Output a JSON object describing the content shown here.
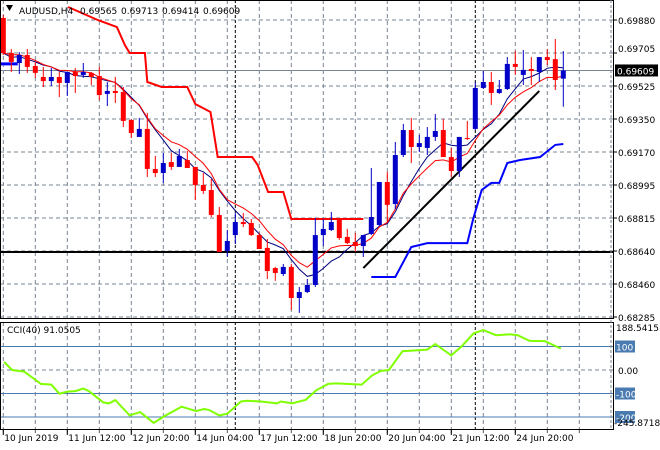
{
  "header": {
    "symbol_tf": "AUDUSD,H4",
    "open": "0.69565",
    "high": "0.69713",
    "low": "0.69414",
    "close": "0.69609"
  },
  "colors": {
    "bull": "#0000c8",
    "bear": "#ff0000",
    "grid": "#7a8696",
    "cci": "#7fff00",
    "level": "#4a7bb0",
    "upper_channel": "#ff0000",
    "lower_channel": "#0000ff",
    "trend": "#000000"
  },
  "chart_data": {
    "type": "candlestick",
    "title": "AUDUSD,H4",
    "ylim": [
      0.682,
      0.6995
    ],
    "y_ticks": [
      "0.69880",
      "0.69705",
      "0.69525",
      "0.69350",
      "0.69170",
      "0.68995",
      "0.68815",
      "0.68640",
      "0.68460",
      "0.68285"
    ],
    "current_price": "0.69609",
    "x_ticks": [
      {
        "index": 0,
        "label": "10 Jun 2019"
      },
      {
        "index": 8,
        "label": "11 Jun 12:00"
      },
      {
        "index": 16,
        "label": "12 Jun 20:00"
      },
      {
        "index": 24,
        "label": "14 Jun 04:00"
      },
      {
        "index": 32,
        "label": "17 Jun 12:00"
      },
      {
        "index": 40,
        "label": "18 Jun 20:00"
      },
      {
        "index": 48,
        "label": "20 Jun 04:00"
      },
      {
        "index": 56,
        "label": "21 Jun 12:00"
      },
      {
        "index": 64,
        "label": "24 Jun 20:00"
      }
    ],
    "period_separators": [
      29,
      59
    ],
    "candles_ohlc": [
      [
        0.69891,
        0.69907,
        0.69692,
        0.69703
      ],
      [
        0.69703,
        0.69724,
        0.69601,
        0.69655
      ],
      [
        0.69649,
        0.69708,
        0.6959,
        0.69692
      ],
      [
        0.69692,
        0.69724,
        0.69596,
        0.69628
      ],
      [
        0.69633,
        0.69655,
        0.69569,
        0.69596
      ],
      [
        0.69574,
        0.69628,
        0.6952,
        0.69552
      ],
      [
        0.69552,
        0.69622,
        0.69526,
        0.69574
      ],
      [
        0.69574,
        0.69601,
        0.69466,
        0.69542
      ],
      [
        0.69542,
        0.69601,
        0.69472,
        0.69601
      ],
      [
        0.69601,
        0.69622,
        0.69488,
        0.69579
      ],
      [
        0.69585,
        0.69649,
        0.69569,
        0.69601
      ],
      [
        0.69596,
        0.69601,
        0.69531,
        0.69574
      ],
      [
        0.69579,
        0.69628,
        0.6945,
        0.69477
      ],
      [
        0.69483,
        0.69547,
        0.69418,
        0.69499
      ],
      [
        0.69499,
        0.69574,
        0.69434,
        0.69488
      ],
      [
        0.69493,
        0.6952,
        0.69305,
        0.69338
      ],
      [
        0.69343,
        0.69348,
        0.69246,
        0.69273
      ],
      [
        0.69252,
        0.69354,
        0.69252,
        0.69295
      ],
      [
        0.69295,
        0.69381,
        0.69037,
        0.6908
      ],
      [
        0.6908,
        0.6915,
        0.69037,
        0.69058
      ],
      [
        0.69058,
        0.69166,
        0.69005,
        0.69112
      ],
      [
        0.69117,
        0.69166,
        0.69075,
        0.69091
      ],
      [
        0.69091,
        0.69187,
        0.69091,
        0.6915
      ],
      [
        0.69128,
        0.69177,
        0.69085,
        0.69085
      ],
      [
        0.69091,
        0.69091,
        0.68913,
        0.68994
      ],
      [
        0.68994,
        0.69058,
        0.68946,
        0.68962
      ],
      [
        0.68967,
        0.69026,
        0.68822,
        0.68833
      ],
      [
        0.68833,
        0.68876,
        0.68634,
        0.68634
      ],
      [
        0.6864,
        0.68752,
        0.68607,
        0.68693
      ],
      [
        0.68725,
        0.68843,
        0.68677,
        0.68795
      ],
      [
        0.68795,
        0.68843,
        0.68768,
        0.68784
      ],
      [
        0.6879,
        0.68811,
        0.6872,
        0.68725
      ],
      [
        0.68725,
        0.68736,
        0.6865,
        0.6865
      ],
      [
        0.68656,
        0.68704,
        0.68489,
        0.68532
      ],
      [
        0.68548,
        0.68554,
        0.68479,
        0.68521
      ],
      [
        0.68516,
        0.6857,
        0.68505,
        0.68554
      ],
      [
        0.68554,
        0.6857,
        0.68323,
        0.68387
      ],
      [
        0.68387,
        0.68446,
        0.68307,
        0.68419
      ],
      [
        0.68419,
        0.68489,
        0.68414,
        0.68457
      ],
      [
        0.68457,
        0.68817,
        0.68446,
        0.68725
      ],
      [
        0.68725,
        0.68811,
        0.68666,
        0.68758
      ],
      [
        0.68752,
        0.68849,
        0.68747,
        0.68795
      ],
      [
        0.68811,
        0.68817,
        0.68699,
        0.68709
      ],
      [
        0.68715,
        0.68758,
        0.68677,
        0.68682
      ],
      [
        0.68688,
        0.68736,
        0.68634,
        0.68666
      ],
      [
        0.68666,
        0.68725,
        0.68607,
        0.68725
      ],
      [
        0.68731,
        0.69085,
        0.68725,
        0.68822
      ],
      [
        0.68779,
        0.6901,
        0.68774,
        0.6901
      ],
      [
        0.6901,
        0.69064,
        0.6879,
        0.68887
      ],
      [
        0.68892,
        0.69225,
        0.68865,
        0.69155
      ],
      [
        0.69155,
        0.69322,
        0.69144,
        0.69289
      ],
      [
        0.69289,
        0.69354,
        0.69112,
        0.69198
      ],
      [
        0.69198,
        0.69262,
        0.69171,
        0.69219
      ],
      [
        0.69193,
        0.69305,
        0.69155,
        0.69252
      ],
      [
        0.69252,
        0.69375,
        0.6923,
        0.69284
      ],
      [
        0.69289,
        0.69348,
        0.69144,
        0.69144
      ],
      [
        0.69144,
        0.69193,
        0.69037,
        0.69069
      ],
      [
        0.69069,
        0.69252,
        0.69037,
        0.69252
      ],
      [
        0.69246,
        0.69338,
        0.69236,
        0.69241
      ],
      [
        0.69295,
        0.69547,
        0.69289,
        0.69515
      ],
      [
        0.69515,
        0.69606,
        0.69509,
        0.69547
      ],
      [
        0.69547,
        0.69601,
        0.69424,
        0.69488
      ],
      [
        0.69488,
        0.69558,
        0.69483,
        0.69509
      ],
      [
        0.69509,
        0.69681,
        0.69504,
        0.69644
      ],
      [
        0.69644,
        0.69714,
        0.69585,
        0.69628
      ],
      [
        0.69585,
        0.69719,
        0.69531,
        0.69612
      ],
      [
        0.69617,
        0.69681,
        0.69531,
        0.69606
      ],
      [
        0.69601,
        0.69681,
        0.69547,
        0.69681
      ],
      [
        0.69681,
        0.69724,
        0.69638,
        0.69665
      ],
      [
        0.6967,
        0.69778,
        0.69504,
        0.69558
      ],
      [
        0.69565,
        0.69713,
        0.69414,
        0.69609
      ]
    ],
    "upper_channel": [
      [
        8.1,
        0.6995
      ],
      [
        11.8,
        0.6988
      ],
      [
        14.2,
        0.69842
      ],
      [
        15.2,
        0.69745
      ],
      [
        15.8,
        0.69703
      ],
      [
        17.7,
        0.69703
      ],
      [
        18,
        0.69547
      ],
      [
        19.8,
        0.6952
      ],
      [
        23,
        0.6952
      ],
      [
        24,
        0.69429
      ],
      [
        25.9,
        0.69386
      ],
      [
        26.8,
        0.69144
      ],
      [
        31.1,
        0.69144
      ],
      [
        31.8,
        0.69101
      ],
      [
        33.1,
        0.68956
      ],
      [
        35,
        0.68956
      ],
      [
        36,
        0.68811
      ],
      [
        45,
        0.68811
      ]
    ],
    "lower_channel_prev": [
      [
        -0.4,
        0.69644
      ],
      [
        1.8,
        0.69644
      ]
    ],
    "lower_channel": [
      [
        46,
        0.685
      ],
      [
        49,
        0.685
      ],
      [
        51,
        0.68661
      ],
      [
        53,
        0.68682
      ],
      [
        58,
        0.68682
      ],
      [
        58.7,
        0.68806
      ],
      [
        59.8,
        0.68967
      ],
      [
        61,
        0.69005
      ],
      [
        62,
        0.69005
      ],
      [
        63,
        0.69112
      ],
      [
        64.6,
        0.69128
      ],
      [
        67.1,
        0.69144
      ],
      [
        69,
        0.69209
      ],
      [
        70,
        0.69214
      ]
    ],
    "support_line": 0.68634,
    "trend_line": {
      "from": [
        45,
        0.68548
      ],
      "to": [
        67,
        0.69499
      ]
    },
    "cci": {
      "label": "CCI(40) 91.0505",
      "max_label": "188.5415",
      "min_label": "-245.8718",
      "zero_label": "0.00",
      "levels": [
        "100",
        "-100",
        "-200"
      ],
      "range": [
        -245.8718,
        188.5415
      ],
      "points": [
        [
          0.1,
          34
        ],
        [
          1.1,
          0
        ],
        [
          2.6,
          -7
        ],
        [
          4.7,
          -59
        ],
        [
          6,
          -62
        ],
        [
          7,
          -101
        ],
        [
          8,
          -92
        ],
        [
          9,
          -90
        ],
        [
          10,
          -79
        ],
        [
          10.7,
          -90
        ],
        [
          12.5,
          -138
        ],
        [
          13.2,
          -142
        ],
        [
          14,
          -128
        ],
        [
          15.8,
          -193
        ],
        [
          17.1,
          -179
        ],
        [
          18.8,
          -225
        ],
        [
          20.3,
          -193
        ],
        [
          22.3,
          -156
        ],
        [
          24.1,
          -175
        ],
        [
          25.1,
          -166
        ],
        [
          25.7,
          -170
        ],
        [
          27,
          -193
        ],
        [
          28,
          -186
        ],
        [
          29.7,
          -134
        ],
        [
          30.5,
          -131
        ],
        [
          32.2,
          -134
        ],
        [
          34.2,
          -142
        ],
        [
          34.7,
          -134
        ],
        [
          36.1,
          -142
        ],
        [
          37.8,
          -127
        ],
        [
          39.1,
          -87
        ],
        [
          40.6,
          -59
        ],
        [
          41.6,
          -57
        ],
        [
          44.8,
          -62
        ],
        [
          46.1,
          -23
        ],
        [
          47.2,
          -4
        ],
        [
          48.2,
          0
        ],
        [
          49.9,
          80
        ],
        [
          53,
          87
        ],
        [
          54,
          110
        ],
        [
          56,
          62
        ],
        [
          57.3,
          101
        ],
        [
          58.8,
          156
        ],
        [
          60,
          170
        ],
        [
          61.6,
          148
        ],
        [
          63.3,
          152
        ],
        [
          64.3,
          148
        ],
        [
          65.8,
          124
        ],
        [
          67.7,
          123
        ],
        [
          69.7,
          91.05
        ]
      ]
    }
  }
}
